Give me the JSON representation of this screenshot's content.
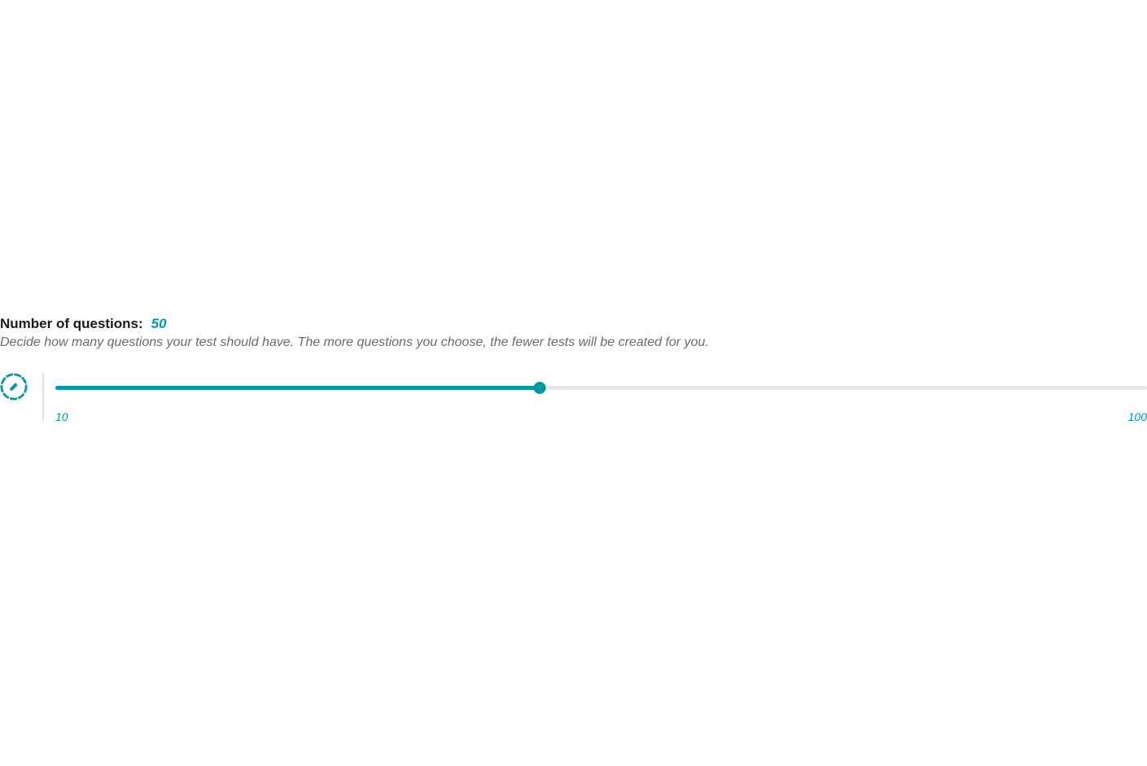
{
  "heading": {
    "label": "Number of questions:",
    "value": "50"
  },
  "description": "Decide how many questions your test should have. The more questions you choose, the fewer tests will be created for you.",
  "slider": {
    "min": 10,
    "max": 100,
    "value": 50,
    "min_label": "10",
    "max_label": "100",
    "fill_percent": "44.4%"
  },
  "icon": {
    "name": "edit-dashed-circle-icon"
  },
  "colors": {
    "accent": "#0097a7",
    "track_bg": "#e6e6e6",
    "text_muted": "#6b6b6b"
  }
}
